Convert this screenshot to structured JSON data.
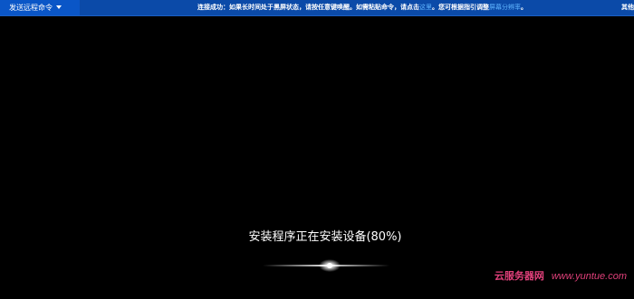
{
  "topbar": {
    "send_command_label": "发送远程命令",
    "notice_prefix": "连接成功：如果长时间处于黑屏状态，请按任意键唤醒。如需粘贴命令，请点击",
    "notice_link1": "这里",
    "notice_middle": "。您可根据指引调整",
    "notice_link2": "屏幕分辨率",
    "notice_suffix": "。",
    "right_text": "其他"
  },
  "installer": {
    "status_text": "安装程序正在安装设备(80%)",
    "progress_percent": 80
  },
  "watermark": {
    "brand_cn": "云服务器网",
    "url": "www.yuntue.com"
  },
  "colors": {
    "background": "#000000",
    "topbar": "#0b4aa8",
    "button": "#0a56c7",
    "link": "#5fb4ff",
    "watermark": "#e0407a"
  },
  "icons": {
    "dropdown": "chevron-down-icon",
    "spinner": "loading-dots-icon"
  }
}
